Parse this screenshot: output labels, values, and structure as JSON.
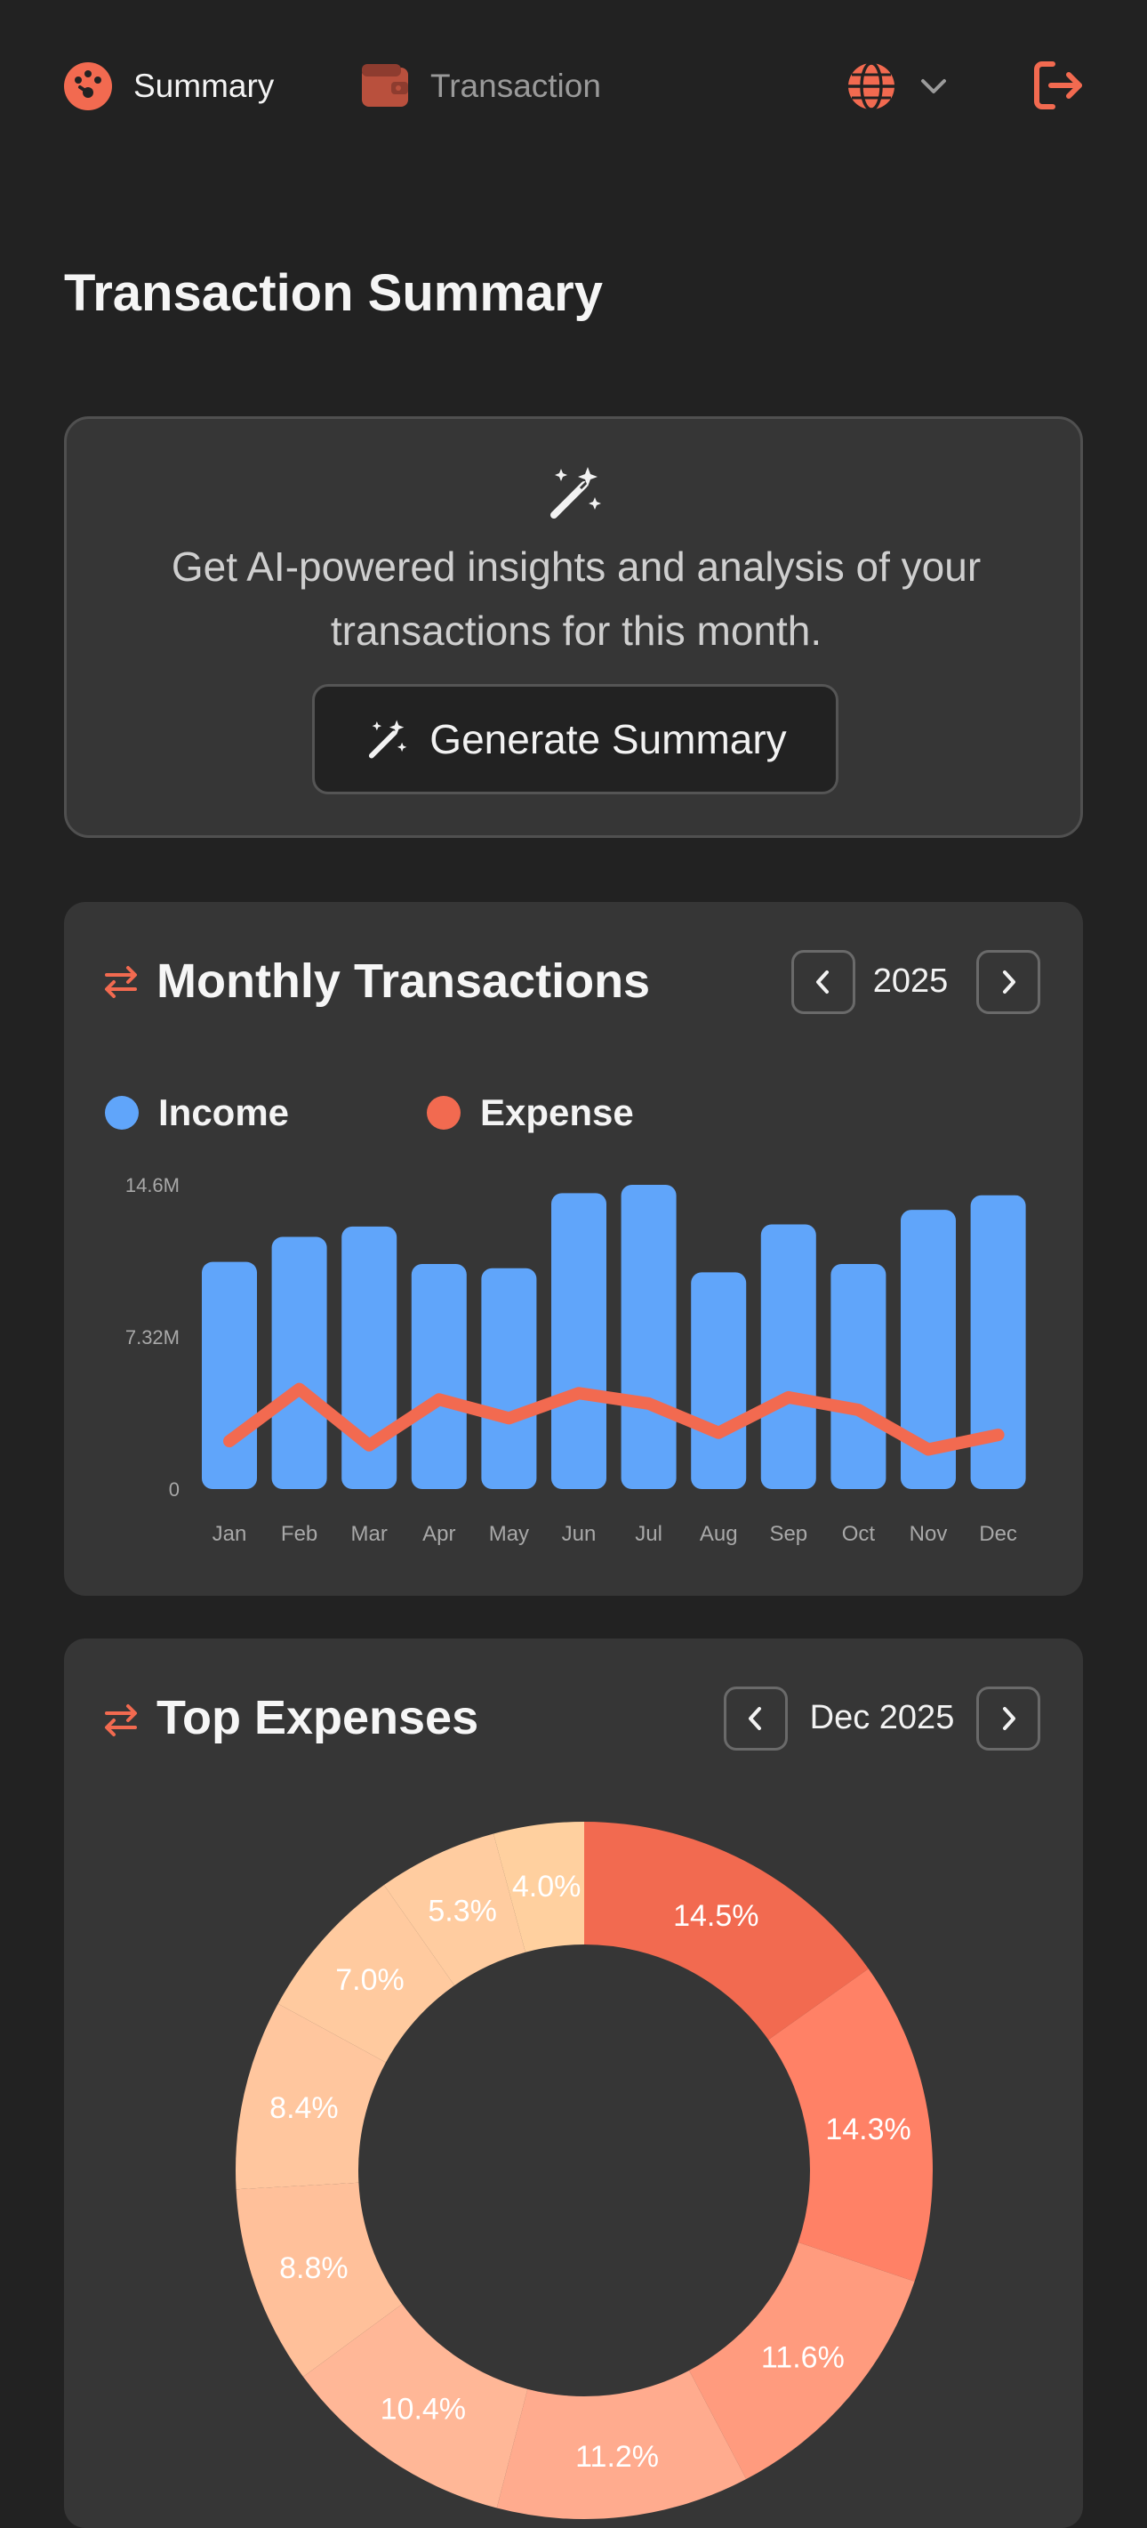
{
  "nav": {
    "summary_label": "Summary",
    "transaction_label": "Transaction",
    "icons": [
      "dashboard-icon",
      "wallet-icon",
      "globe-icon",
      "chevron-down-icon",
      "logout-icon"
    ]
  },
  "page": {
    "title": "Transaction Summary"
  },
  "ai_card": {
    "text_line1": "Get AI-powered insights and analysis of your",
    "text_line2": "transactions for this month.",
    "button_label": "Generate Summary"
  },
  "monthly": {
    "title": "Monthly Transactions",
    "year": "2025",
    "legend_income": "Income",
    "legend_expense": "Expense"
  },
  "expenses": {
    "title": "Top Expenses",
    "period": "Dec 2025"
  },
  "colors": {
    "accent": "#F26A50",
    "income": "#60A5FA",
    "expense": "#F26A50",
    "card": "#363636",
    "background": "#222222"
  },
  "chart_data": [
    {
      "type": "bar",
      "categories": [
        "Jan",
        "Feb",
        "Mar",
        "Apr",
        "May",
        "Jun",
        "Jul",
        "Aug",
        "Sep",
        "Oct",
        "Nov",
        "Dec"
      ],
      "yticks": [
        "0",
        "7.32M",
        "14.6M"
      ],
      "ylim": [
        0,
        14.6
      ],
      "grid": false,
      "legend": "top-left",
      "series": [
        {
          "name": "Income",
          "type": "bar",
          "values": [
            10.9,
            12.1,
            12.6,
            10.8,
            10.6,
            14.2,
            14.6,
            10.4,
            12.7,
            10.8,
            13.4,
            14.1
          ]
        },
        {
          "name": "Expense",
          "type": "line",
          "values": [
            2.3,
            4.8,
            2.1,
            4.3,
            3.4,
            4.6,
            4.1,
            2.7,
            4.4,
            3.8,
            1.9,
            2.6
          ]
        }
      ]
    },
    {
      "type": "pie",
      "labels": [
        "14.5%",
        "14.3%",
        "11.6%",
        "11.2%",
        "10.4%",
        "8.8%",
        "8.4%",
        "7.0%",
        "5.3%",
        "4.0%"
      ],
      "values": [
        14.5,
        14.3,
        11.6,
        11.2,
        10.4,
        8.8,
        8.4,
        7.0,
        5.3,
        4.0
      ],
      "colors": [
        "#F26A50",
        "#FF8166",
        "#FF9B7E",
        "#FFAB8E",
        "#FFB797",
        "#FFC09A",
        "#FFC69E",
        "#FFCA9F",
        "#FFCCA0",
        "#FFD09F"
      ]
    }
  ]
}
